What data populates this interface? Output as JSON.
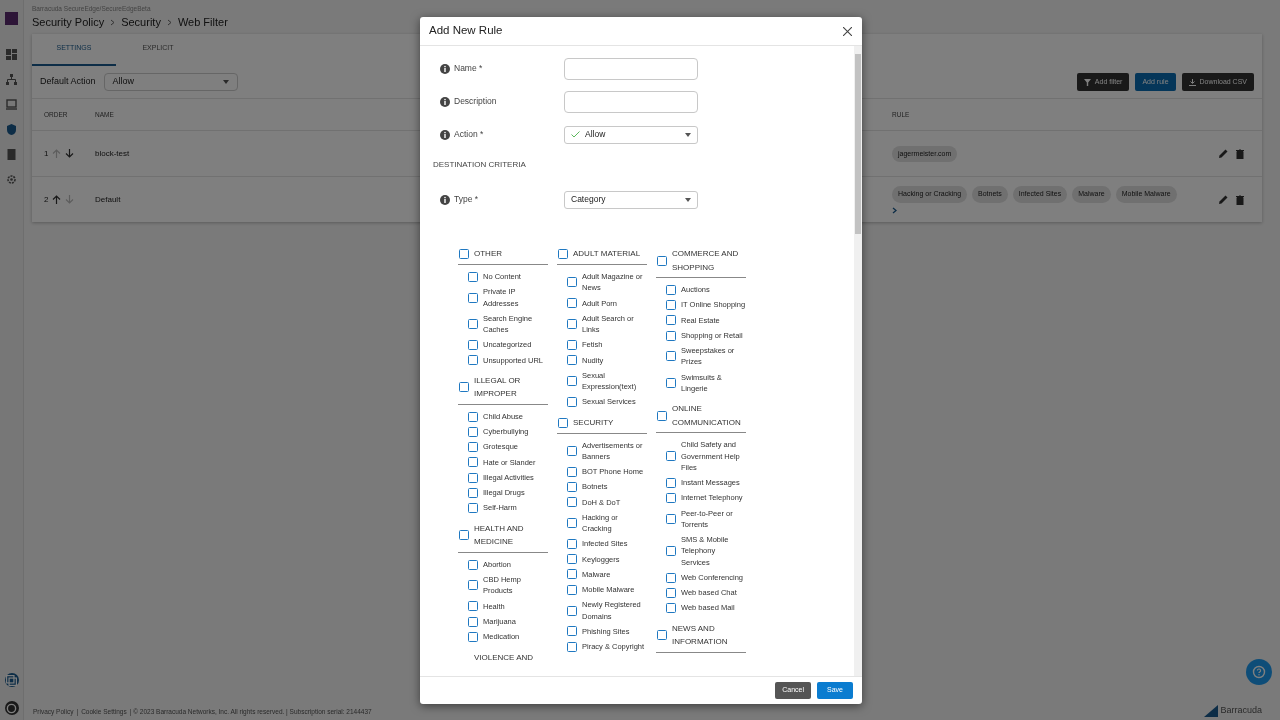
{
  "app": {
    "org": "Barracuda SecureEdge/SecureEdgeBeta",
    "breadcrumbs": [
      "Security Policy",
      "Security",
      "Web Filter"
    ],
    "tabs": [
      {
        "label": "SETTINGS",
        "selected": true
      },
      {
        "label": "EXPLICIT",
        "selected": false
      }
    ],
    "default_action": {
      "label": "Default Action",
      "value": "Allow"
    },
    "toolbar_buttons": [
      {
        "label": "Add filter",
        "kind": "filter"
      },
      {
        "label": "Add rule",
        "kind": "primary"
      },
      {
        "label": "Download CSV",
        "kind": "download"
      }
    ],
    "table": {
      "columns": [
        "ORDER",
        "NAME",
        "RULE"
      ],
      "rows": [
        {
          "order": "1",
          "name": "block-test",
          "up_enabled": false,
          "down_enabled": true,
          "tags": [
            "jagermeister.com"
          ],
          "expandable": false
        },
        {
          "order": "2",
          "name": "Default",
          "up_enabled": true,
          "down_enabled": false,
          "tags": [
            "Hacking or Cracking",
            "Botnets",
            "Infected Sites",
            "Malware",
            "Mobile Malware"
          ],
          "expandable": true
        }
      ]
    },
    "footer": {
      "links": [
        "Privacy Policy",
        "Cookie Settings"
      ],
      "separator": "|",
      "text": "| © 2023 Barracuda Networks, Inc. All rights reserved. | Subscription serial: 2144437"
    },
    "brand": "Barracuda"
  },
  "modal": {
    "title": "Add New Rule",
    "fields": [
      {
        "label": "Name *",
        "kind": "text"
      },
      {
        "label": "Description",
        "kind": "text"
      },
      {
        "label": "Action *",
        "kind": "action_select",
        "value": "Allow"
      }
    ],
    "section_heading": "DESTINATION CRITERIA",
    "type_field": {
      "label": "Type *",
      "kind": "select",
      "value": "Category"
    },
    "category_columns": [
      [
        {
          "title": "OTHER",
          "checked": false,
          "items": [
            {
              "label": "No Content",
              "checked": false
            },
            {
              "label": "Private IP Addresses",
              "checked": false
            },
            {
              "label": "Search Engine Caches",
              "checked": false
            },
            {
              "label": "Uncategorized",
              "checked": false
            },
            {
              "label": "Unsupported URL",
              "checked": false
            }
          ]
        },
        {
          "title": "ILLEGAL OR IMPROPER",
          "checked": false,
          "items": [
            {
              "label": "Child Abuse",
              "checked": false
            },
            {
              "label": "Cyberbullying",
              "checked": false
            },
            {
              "label": "Grotesque",
              "checked": false
            },
            {
              "label": "Hate or Slander",
              "checked": false
            },
            {
              "label": "Illegal Activities",
              "checked": false
            },
            {
              "label": "Illegal Drugs",
              "checked": false
            },
            {
              "label": "Self-Harm",
              "checked": false
            }
          ]
        },
        {
          "title": "HEALTH AND MEDICINE",
          "checked": false,
          "items": [
            {
              "label": "Abortion",
              "checked": false
            },
            {
              "label": "CBD Hemp Products",
              "checked": false
            },
            {
              "label": "Health",
              "checked": false
            },
            {
              "label": "Marijuana",
              "checked": false
            },
            {
              "label": "Medication",
              "checked": false
            }
          ]
        },
        {
          "title": "VIOLENCE AND"
        }
      ],
      [
        {
          "title": "ADULT MATERIAL",
          "checked": false,
          "items": [
            {
              "label": "Adult Magazine or News",
              "checked": false
            },
            {
              "label": "Adult Porn",
              "checked": false
            },
            {
              "label": "Adult Search or Links",
              "checked": false
            },
            {
              "label": "Fetish",
              "checked": false
            },
            {
              "label": "Nudity",
              "checked": false
            },
            {
              "label": "Sexual Expression(text)",
              "checked": false
            },
            {
              "label": "Sexual Services",
              "checked": false
            }
          ]
        },
        {
          "title": "SECURITY",
          "checked": false,
          "items": [
            {
              "label": "Advertisements or Banners",
              "checked": false
            },
            {
              "label": "BOT Phone Home",
              "checked": false
            },
            {
              "label": "Botnets",
              "checked": false
            },
            {
              "label": "DoH & DoT",
              "checked": false
            },
            {
              "label": "Hacking or Cracking",
              "checked": false
            },
            {
              "label": "Infected Sites",
              "checked": false
            },
            {
              "label": "Keyloggers",
              "checked": false
            },
            {
              "label": "Malware",
              "checked": false
            },
            {
              "label": "Mobile Malware",
              "checked": false
            },
            {
              "label": "Newly Registered Domains",
              "checked": false
            },
            {
              "label": "Phishing Sites",
              "checked": false
            },
            {
              "label": "Piracy & Copyright",
              "checked": false
            }
          ]
        }
      ],
      [
        {
          "title": "COMMERCE AND SHOPPING",
          "checked": false,
          "items": [
            {
              "label": "Auctions",
              "checked": false
            },
            {
              "label": "IT Online Shopping",
              "checked": false
            },
            {
              "label": "Real Estate",
              "checked": false
            },
            {
              "label": "Shopping or Retail",
              "checked": false
            },
            {
              "label": "Sweepstakes or Prizes",
              "checked": false
            },
            {
              "label": "Swimsuits & Lingerie",
              "checked": false
            }
          ]
        },
        {
          "title": "ONLINE COMMUNICATION",
          "checked": false,
          "items": [
            {
              "label": "Child Safety and Government Help Files",
              "checked": false
            },
            {
              "label": "Instant Messages",
              "checked": false
            },
            {
              "label": "Internet Telephony",
              "checked": false
            },
            {
              "label": "Peer-to-Peer or Torrents",
              "checked": false
            },
            {
              "label": "SMS & Mobile Telephony Services",
              "checked": false
            },
            {
              "label": "Web Conferencing",
              "checked": false
            },
            {
              "label": "Web based Chat",
              "checked": false
            },
            {
              "label": "Web based Mail",
              "checked": false
            }
          ]
        },
        {
          "title": "NEWS AND INFORMATION",
          "checked": false
        }
      ]
    ],
    "buttons": [
      {
        "label": "Cancel",
        "kind": "secondary"
      },
      {
        "label": "Save",
        "kind": "primary"
      }
    ]
  }
}
